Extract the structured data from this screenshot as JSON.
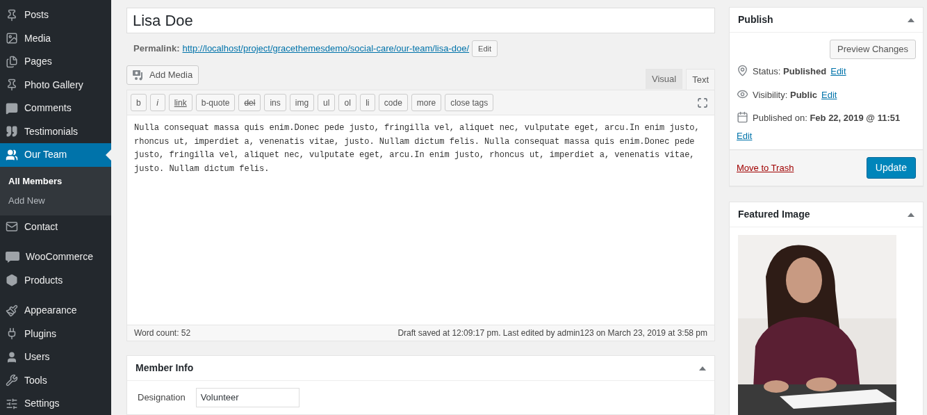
{
  "sidebar": {
    "groups": [
      {
        "items": [
          {
            "label": "Posts",
            "selected": false
          },
          {
            "label": "Media",
            "selected": false
          },
          {
            "label": "Pages",
            "selected": false
          },
          {
            "label": "Photo Gallery",
            "selected": false
          },
          {
            "label": "Comments",
            "selected": false
          },
          {
            "label": "Testimonials",
            "selected": false
          },
          {
            "label": "Our Team",
            "selected": true,
            "children": [
              {
                "label": "All Members",
                "selected": true
              },
              {
                "label": "Add New",
                "selected": false
              }
            ]
          },
          {
            "label": "Contact",
            "selected": false
          }
        ]
      },
      {
        "items": [
          {
            "label": "WooCommerce",
            "selected": false
          },
          {
            "label": "Products",
            "selected": false
          }
        ]
      },
      {
        "items": [
          {
            "label": "Appearance",
            "selected": false
          },
          {
            "label": "Plugins",
            "selected": false
          },
          {
            "label": "Users",
            "selected": false
          },
          {
            "label": "Tools",
            "selected": false
          },
          {
            "label": "Settings",
            "selected": false
          }
        ]
      }
    ]
  },
  "post": {
    "title": "Lisa Doe",
    "permalink_label": "Permalink:",
    "permalink": "http://localhost/project/gracethemesdemo/social-care/our-team/lisa-doe/",
    "permalink_edit": "Edit"
  },
  "editor": {
    "add_media": "Add Media",
    "tabs": [
      {
        "label": "Visual",
        "selected": false
      },
      {
        "label": "Text",
        "selected": true
      }
    ],
    "toolbar": [
      {
        "label": "b",
        "kind": "plain"
      },
      {
        "label": "i",
        "kind": "italic"
      },
      {
        "label": "link",
        "kind": "underline"
      },
      {
        "label": "b-quote",
        "kind": "plain"
      },
      {
        "label": "del",
        "kind": "strike"
      },
      {
        "label": "ins",
        "kind": "plain"
      },
      {
        "label": "img",
        "kind": "plain"
      },
      {
        "label": "ul",
        "kind": "plain"
      },
      {
        "label": "ol",
        "kind": "plain"
      },
      {
        "label": "li",
        "kind": "plain"
      },
      {
        "label": "code",
        "kind": "plain"
      },
      {
        "label": "more",
        "kind": "plain"
      },
      {
        "label": "close tags",
        "kind": "plain"
      }
    ],
    "content": "Nulla consequat massa quis enim.Donec pede justo, fringilla vel, aliquet nec, vulputate eget, arcu.In enim justo, rhoncus ut, imperdiet a, venenatis vitae, justo. Nullam dictum felis. Nulla consequat massa quis enim.Donec pede justo, fringilla vel, aliquet nec, vulputate eget, arcu.In enim justo, rhoncus ut, imperdiet a, venenatis vitae, justo. Nullam dictum felis.",
    "word_count": "Word count: 52",
    "draft_status": "Draft saved at 12:09:17 pm. Last edited by admin123 on March 23, 2019 at 3:58 pm"
  },
  "member_info": {
    "title": "Member Info",
    "fields": [
      {
        "label": "Designation",
        "value": "Volunteer"
      }
    ]
  },
  "publish": {
    "title": "Publish",
    "preview": "Preview Changes",
    "rows": [
      {
        "label": "Status:",
        "value": "Published",
        "link": "Edit"
      },
      {
        "label": "Visibility:",
        "value": "Public",
        "link": "Edit"
      },
      {
        "label": "Published on:",
        "value": "Feb 22, 2019 @ 11:51",
        "link": "Edit"
      }
    ],
    "trash": "Move to Trash",
    "update": "Update"
  },
  "featured_image": {
    "title": "Featured Image",
    "kind": "picture"
  }
}
